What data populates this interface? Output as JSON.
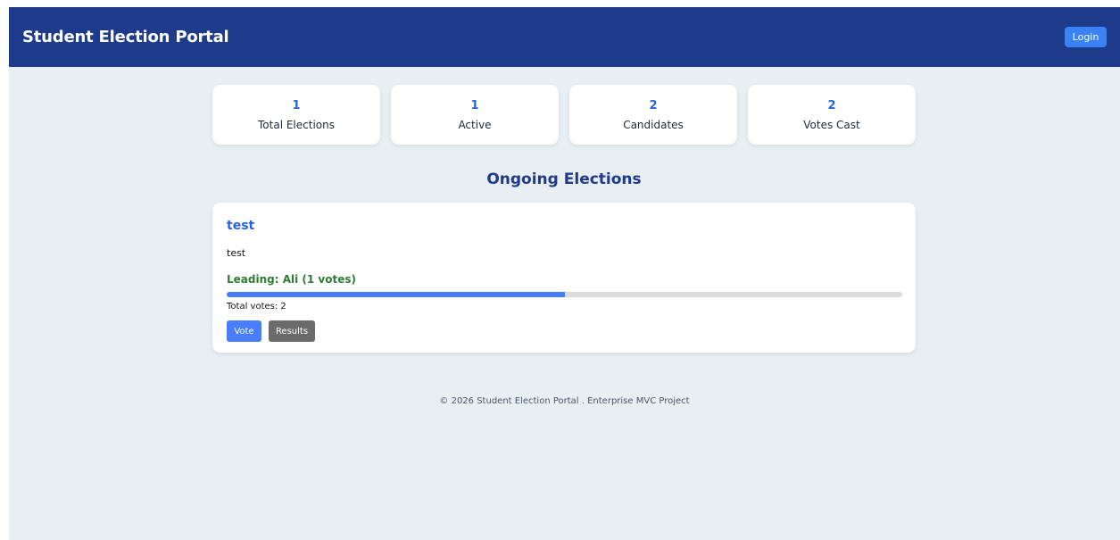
{
  "header": {
    "brand": "Student Election Portal",
    "login_label": "Login"
  },
  "stats": [
    {
      "value": "1",
      "label": "Total Elections"
    },
    {
      "value": "1",
      "label": "Active"
    },
    {
      "value": "2",
      "label": "Candidates"
    },
    {
      "value": "2",
      "label": "Votes Cast"
    }
  ],
  "section_title": "Ongoing Elections",
  "election": {
    "title": "test",
    "description": "test",
    "leading": "Leading: Ali (1 votes)",
    "progress_fraction": 0.5,
    "total_votes": "Total votes: 2",
    "vote_label": "Vote",
    "results_label": "Results"
  },
  "footer": "© 2026 Student Election Portal . Enterprise MVC Project",
  "colors": {
    "header_bg": "#1e3a8a",
    "accent": "#2563eb",
    "leading": "#2e7d32",
    "vote_button": "#4a7dfc",
    "results_button": "#6b6b6b"
  }
}
